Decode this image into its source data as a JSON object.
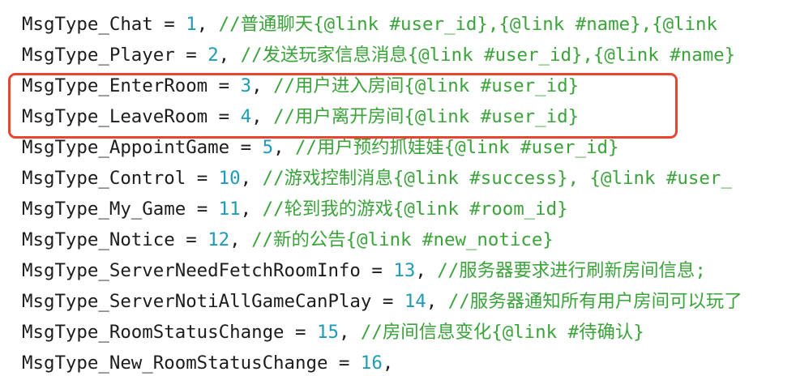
{
  "code_lines": [
    {
      "name": "MsgType_Chat",
      "value": "1",
      "comment": "//普通聊天{@link #user_id},{@link #name},{@link"
    },
    {
      "name": "MsgType_Player",
      "value": "2",
      "comment": "//发送玩家信息消息{@link #user_id},{@link #name}"
    },
    {
      "name": "MsgType_EnterRoom",
      "value": "3",
      "comment": "//用户进入房间{@link #user_id}"
    },
    {
      "name": "MsgType_LeaveRoom",
      "value": "4",
      "comment": "//用户离开房间{@link #user_id}"
    },
    {
      "name": "MsgType_AppointGame",
      "value": "5",
      "comment": "//用户预约抓娃娃{@link #user_id}"
    },
    {
      "name": "MsgType_Control",
      "value": "10",
      "comment": "//游戏控制消息{@link #success}, {@link #user_"
    },
    {
      "name": "MsgType_My_Game",
      "value": "11",
      "comment": "//轮到我的游戏{@link #room_id}"
    },
    {
      "name": "MsgType_Notice",
      "value": "12",
      "comment": "//新的公告{@link #new_notice}"
    },
    {
      "name": "MsgType_ServerNeedFetchRoomInfo",
      "value": "13",
      "comment": "//服务器要求进行刷新房间信息;"
    },
    {
      "name": "MsgType_ServerNotiAllGameCanPlay",
      "value": "14",
      "comment": "//服务器通知所有用户房间可以玩了"
    },
    {
      "name": "MsgType_RoomStatusChange",
      "value": "15",
      "comment": "//房间信息变化{@link #待确认}"
    },
    {
      "name": "MsgType_New_RoomStatusChange",
      "value": "16",
      "comment": ""
    }
  ],
  "tokens": {
    "assign": " = ",
    "separator": ", "
  },
  "colors": {
    "identifier": "#1c1c1c",
    "number": "#1e9bb6",
    "comment": "#3aa33a",
    "highlight": "#e8442f",
    "background": "#ffffff"
  }
}
